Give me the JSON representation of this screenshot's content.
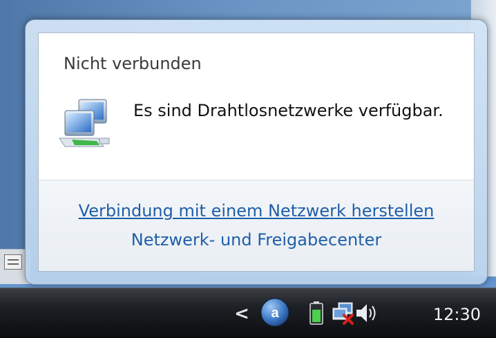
{
  "notification": {
    "title": "Nicht verbunden",
    "message": "Es sind Drahtlosnetzwerke verfügbar.",
    "link_connect": "Verbindung mit einem Netzwerk herstellen",
    "link_center": "Netzwerk- und Freigabecenter"
  },
  "taskbar": {
    "show_hidden_icons": "<",
    "app_icon_letter": "a",
    "clock": "12:30"
  },
  "colors": {
    "link": "#1f5ea8",
    "taskbar": "#1e2126",
    "error_red": "#d8211c"
  },
  "icons": [
    "network-computers-icon",
    "app-tray-icon",
    "battery-icon",
    "network-disconnected-icon",
    "volume-icon"
  ]
}
